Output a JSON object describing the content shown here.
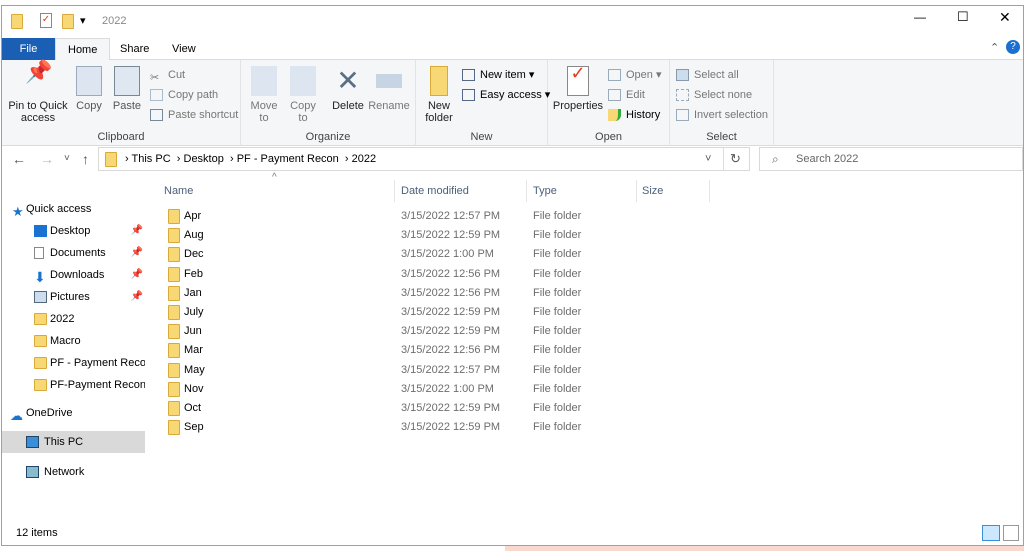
{
  "title": "2022",
  "window_controls": {
    "minimize": "—",
    "maximize": "☐",
    "close": "✕"
  },
  "tabs": [
    "File",
    "Home",
    "Share",
    "View"
  ],
  "ribbon": {
    "clipboard": {
      "label": "Clipboard",
      "pin": "Pin to Quick access",
      "copy": "Copy",
      "paste": "Paste",
      "cut": "Cut",
      "copy_path": "Copy path",
      "paste_shortcut": "Paste shortcut"
    },
    "organize": {
      "label": "Organize",
      "move_to": "Move to",
      "copy_to": "Copy to",
      "delete": "Delete",
      "rename": "Rename"
    },
    "new": {
      "label": "New",
      "new_folder": "New folder",
      "new_item": "New item",
      "easy_access": "Easy access"
    },
    "open": {
      "label": "Open",
      "properties": "Properties",
      "open": "Open",
      "edit": "Edit",
      "history": "History"
    },
    "select": {
      "label": "Select",
      "select_all": "Select all",
      "select_none": "Select none",
      "invert": "Invert selection"
    }
  },
  "breadcrumb": [
    "This PC",
    "Desktop",
    "PF - Payment Recon",
    "2022"
  ],
  "search_placeholder": "Search 2022",
  "sidebar": {
    "quick_access": "Quick access",
    "items": [
      "Desktop",
      "Documents",
      "Downloads",
      "Pictures",
      "2022",
      "Macro",
      "PF - Payment Recon",
      "PF-Payment Recon"
    ],
    "onedrive": "OneDrive",
    "thispc": "This PC",
    "network": "Network"
  },
  "columns": [
    "Name",
    "Date modified",
    "Type",
    "Size"
  ],
  "files": [
    {
      "name": "Apr",
      "date": "3/15/2022 12:57 PM",
      "type": "File folder"
    },
    {
      "name": "Aug",
      "date": "3/15/2022 12:59 PM",
      "type": "File folder"
    },
    {
      "name": "Dec",
      "date": "3/15/2022 1:00 PM",
      "type": "File folder"
    },
    {
      "name": "Feb",
      "date": "3/15/2022 12:56 PM",
      "type": "File folder"
    },
    {
      "name": "Jan",
      "date": "3/15/2022 12:56 PM",
      "type": "File folder"
    },
    {
      "name": "July",
      "date": "3/15/2022 12:59 PM",
      "type": "File folder"
    },
    {
      "name": "Jun",
      "date": "3/15/2022 12:59 PM",
      "type": "File folder"
    },
    {
      "name": "Mar",
      "date": "3/15/2022 12:56 PM",
      "type": "File folder"
    },
    {
      "name": "May",
      "date": "3/15/2022 12:57 PM",
      "type": "File folder"
    },
    {
      "name": "Nov",
      "date": "3/15/2022 1:00 PM",
      "type": "File folder"
    },
    {
      "name": "Oct",
      "date": "3/15/2022 12:59 PM",
      "type": "File folder"
    },
    {
      "name": "Sep",
      "date": "3/15/2022 12:59 PM",
      "type": "File folder"
    }
  ],
  "status": "12 items"
}
